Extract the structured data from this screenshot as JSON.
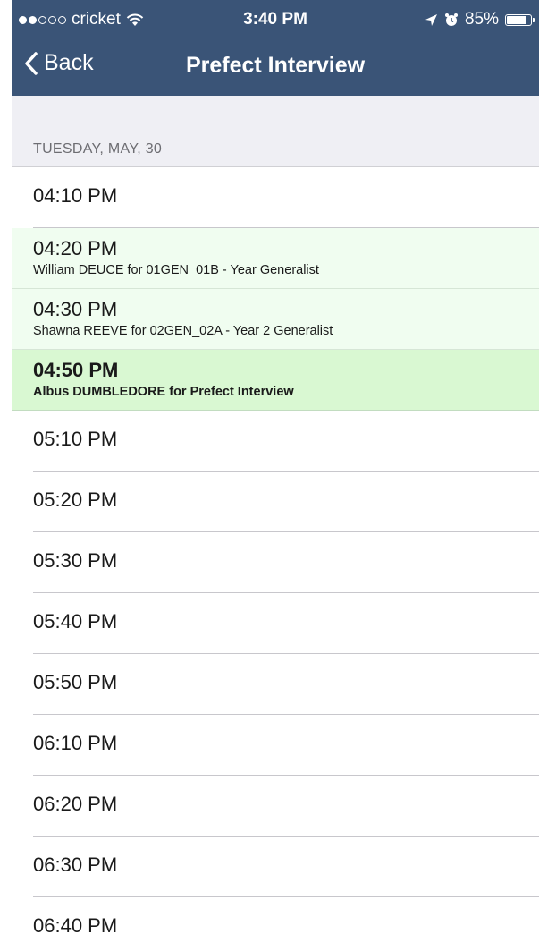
{
  "status_bar": {
    "carrier": "cricket",
    "time": "3:40 PM",
    "battery": "85%",
    "signal_bars_filled": 2,
    "signal_bars_total": 5
  },
  "nav": {
    "back_label": "Back",
    "title": "Prefect Interview"
  },
  "section": {
    "label": "TUESDAY, MAY, 30"
  },
  "slots": [
    {
      "time": "04:10 PM",
      "detail": "",
      "state": "free"
    },
    {
      "time": "04:20 PM",
      "detail": "William DEUCE for 01GEN_01B - Year  Generalist",
      "state": "booked"
    },
    {
      "time": "04:30 PM",
      "detail": "Shawna REEVE for 02GEN_02A - Year 2 Generalist",
      "state": "booked"
    },
    {
      "time": "04:50 PM",
      "detail": "Albus DUMBLEDORE for Prefect Interview",
      "state": "current"
    },
    {
      "time": "05:10 PM",
      "detail": "",
      "state": "free"
    },
    {
      "time": "05:20 PM",
      "detail": "",
      "state": "free"
    },
    {
      "time": "05:30 PM",
      "detail": "",
      "state": "free"
    },
    {
      "time": "05:40 PM",
      "detail": "",
      "state": "free"
    },
    {
      "time": "05:50 PM",
      "detail": "",
      "state": "free"
    },
    {
      "time": "06:10 PM",
      "detail": "",
      "state": "free"
    },
    {
      "time": "06:20 PM",
      "detail": "",
      "state": "free"
    },
    {
      "time": "06:30 PM",
      "detail": "",
      "state": "free"
    },
    {
      "time": "06:40 PM",
      "detail": "",
      "state": "free"
    }
  ],
  "colors": {
    "header_bg": "#3a5477",
    "booked_bg": "#f0fdf0",
    "current_bg": "#d9f8d2",
    "section_bg": "#efeff4"
  }
}
